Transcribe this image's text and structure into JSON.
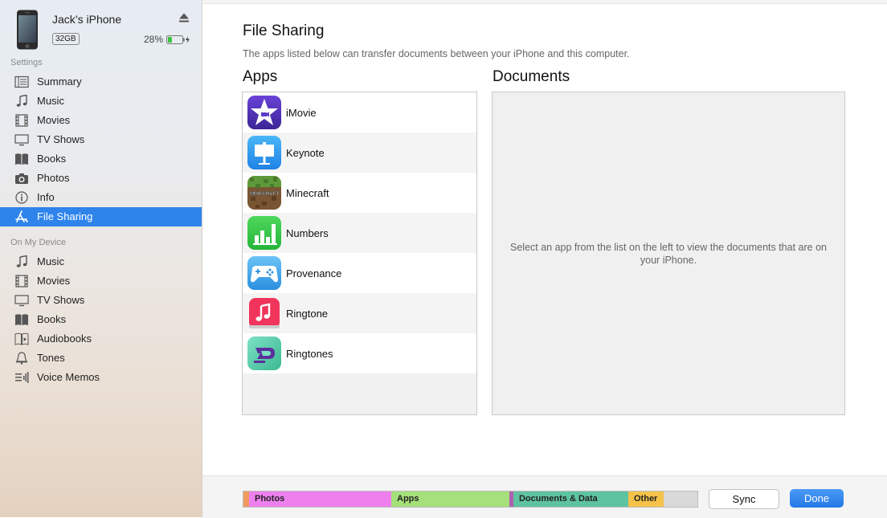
{
  "device": {
    "name": "Jack’s iPhone",
    "capacity": "32GB",
    "battery_percent": "28%",
    "battery_level": 0.28
  },
  "sidebar": {
    "settings_header": "Settings",
    "settings_items": [
      {
        "label": "Summary",
        "icon": "summary-icon"
      },
      {
        "label": "Music",
        "icon": "music-note-icon"
      },
      {
        "label": "Movies",
        "icon": "film-icon"
      },
      {
        "label": "TV Shows",
        "icon": "tv-icon"
      },
      {
        "label": "Books",
        "icon": "book-icon"
      },
      {
        "label": "Photos",
        "icon": "camera-icon"
      },
      {
        "label": "Info",
        "icon": "info-icon"
      },
      {
        "label": "File Sharing",
        "icon": "app-store-icon",
        "active": true
      }
    ],
    "device_header": "On My Device",
    "device_items": [
      {
        "label": "Music",
        "icon": "music-note-icon"
      },
      {
        "label": "Movies",
        "icon": "film-icon"
      },
      {
        "label": "TV Shows",
        "icon": "tv-icon"
      },
      {
        "label": "Books",
        "icon": "book-icon"
      },
      {
        "label": "Audiobooks",
        "icon": "audiobook-icon"
      },
      {
        "label": "Tones",
        "icon": "bell-icon"
      },
      {
        "label": "Voice Memos",
        "icon": "voice-memos-icon"
      }
    ]
  },
  "main": {
    "title": "File Sharing",
    "description": "The apps listed below can transfer documents between your iPhone and this computer.",
    "apps_header": "Apps",
    "documents_header": "Documents",
    "documents_empty": "Select an app from the list on the left to view the documents that are on your iPhone.",
    "apps": [
      {
        "name": "iMovie",
        "icon": "imovie-icon"
      },
      {
        "name": "Keynote",
        "icon": "keynote-icon"
      },
      {
        "name": "Minecraft",
        "icon": "minecraft-icon",
        "icon_text": "MINECRAFT"
      },
      {
        "name": "Numbers",
        "icon": "numbers-icon"
      },
      {
        "name": "Provenance",
        "icon": "provenance-icon"
      },
      {
        "name": "Ringtone",
        "icon": "ringtone-icon"
      },
      {
        "name": "Ringtones",
        "icon": "ringtones-icon"
      }
    ]
  },
  "footer": {
    "storage": [
      {
        "label": "",
        "color": "#f09a5e"
      },
      {
        "label": "Photos",
        "color": "#ee80ee"
      },
      {
        "label": "Apps",
        "color": "#a6e07a"
      },
      {
        "label": "",
        "color": "#b060b0"
      },
      {
        "label": "Documents & Data",
        "color": "#5ec3a0"
      },
      {
        "label": "Other",
        "color": "#f5c249"
      },
      {
        "label": "",
        "color": "#d9d9d9"
      }
    ],
    "sync_label": "Sync",
    "done_label": "Done"
  },
  "colors": {
    "accent": "#2f84ec"
  }
}
